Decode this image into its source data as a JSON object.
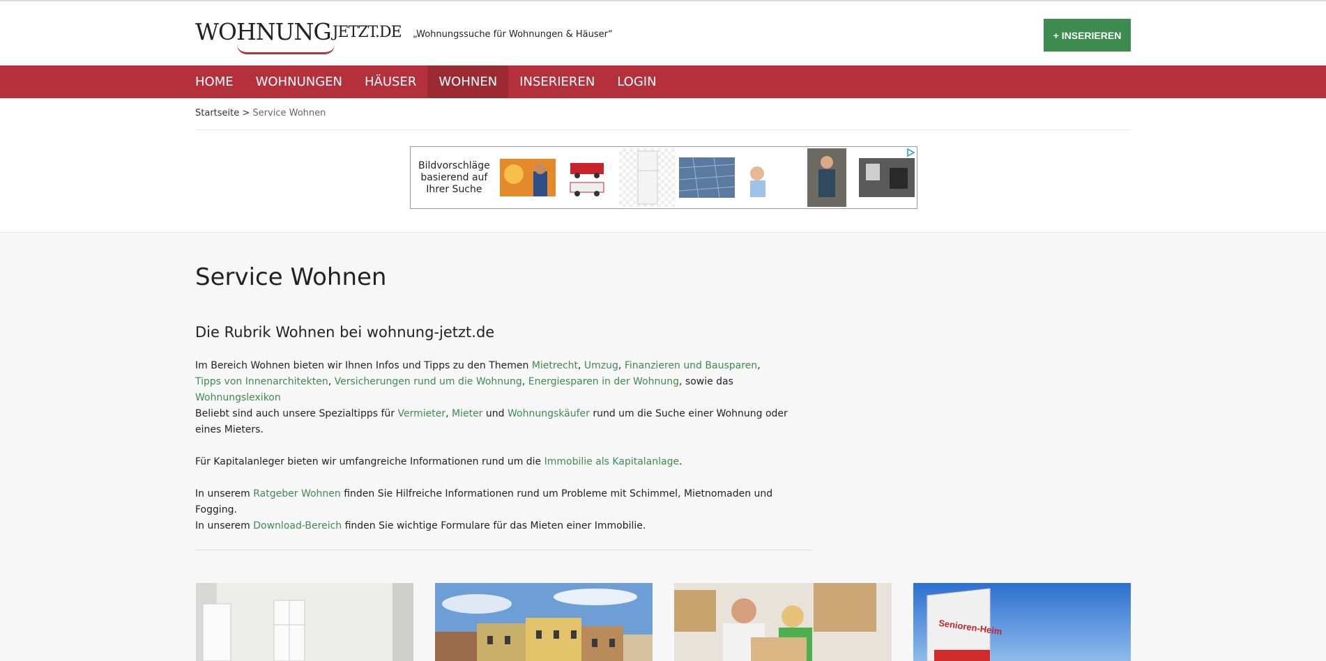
{
  "logo": {
    "main": "WOHNUNG",
    "sub": "JETZT.DE"
  },
  "tagline": "„Wohnungssuche für Wohnungen & Häuser“",
  "insert_button": "+ INSERIEREN",
  "nav": [
    {
      "label": "HOME"
    },
    {
      "label": "WOHNUNGEN"
    },
    {
      "label": "HÄUSER"
    },
    {
      "label": "WOHNEN",
      "active": true
    },
    {
      "label": "INSERIEREN"
    },
    {
      "label": "LOGIN"
    }
  ],
  "breadcrumb": {
    "home": "Startseite",
    "separator": " > ",
    "current": "Service Wohnen"
  },
  "ad": {
    "text": "Bildvorschläge basierend auf Ihrer Suche",
    "info_icon": "adchoices-icon"
  },
  "page_title": "Service Wohnen",
  "section_title": "Die Rubrik Wohnen bei wohnung-jetzt.de",
  "p1": {
    "t1": "Im Bereich Wohnen bieten wir Ihnen Infos und Tipps zu den Themen ",
    "l1": "Mietrecht",
    "s1": ", ",
    "l2": "Umzug",
    "s2": ", ",
    "l3": "Finanzieren und Bausparen",
    "s3": ", ",
    "l4": "Tipps von Innenarchitekten",
    "s4": ", ",
    "l5": "Versicherungen rund um die Wohnung",
    "s5": ", ",
    "l6": "Energiesparen in der Wohnung",
    "s6": ", sowie das ",
    "l7": "Wohnungslexikon"
  },
  "p2": {
    "t1": "Beliebt sind auch unsere Spezialtipps für ",
    "l1": "Vermieter",
    "s1": ", ",
    "l2": "Mieter",
    "s2": " und ",
    "l3": "Wohnungskäufer",
    "t2": " rund um die Suche einer Wohnung oder eines Mieters."
  },
  "p3": {
    "t1": "Für Kapitalanleger bieten wir umfangreiche Informationen rund um die ",
    "l1": "Immobilie als Kapitalanlage",
    "t2": "."
  },
  "p4": {
    "t1": "In unserem ",
    "l1": "Ratgeber Wohnen",
    "t2": " finden Sie Hilfreiche Informationen rund um Probleme mit Schimmel, Mietnomaden und Fogging."
  },
  "p5": {
    "t1": "In unserem ",
    "l1": "Download-Bereich",
    "t2": " finden Sie wichtige Formulare für das Mieten einer Immobilie."
  },
  "cards": [
    {
      "image": "empty-room-image"
    },
    {
      "image": "houses-facade-image"
    },
    {
      "image": "moving-couple-image"
    },
    {
      "image": "seniors-home-sign-image",
      "sign": "Senioren-Heim"
    }
  ],
  "colors": {
    "brand_red": "#b4313b",
    "nav_active": "#9c2a33",
    "green": "#3d8b4f"
  }
}
